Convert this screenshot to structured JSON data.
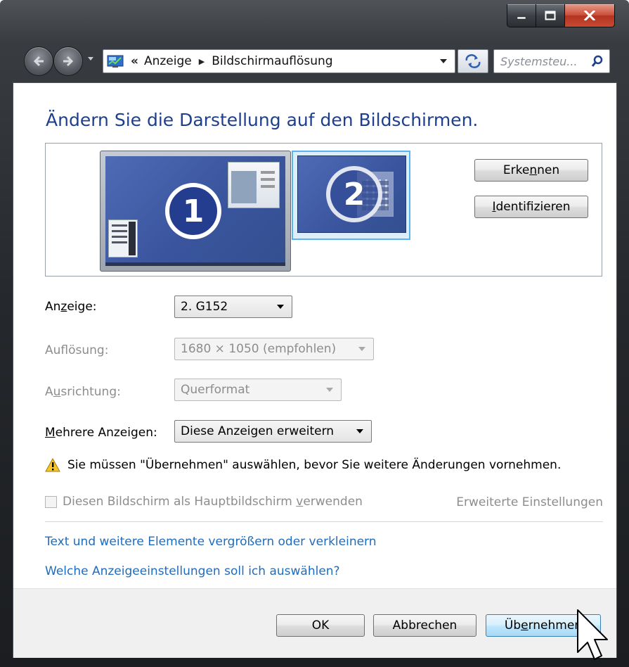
{
  "window": {
    "caption_buttons": [
      "minimize",
      "maximize",
      "close"
    ]
  },
  "navigation": {
    "address_separator": "«",
    "breadcrumb": [
      "Anzeige",
      "Bildschirmauflösung"
    ],
    "search_placeholder": "Systemsteu..."
  },
  "main": {
    "heading": "Ändern Sie die Darstellung auf den Bildschirmen.",
    "preview": {
      "monitors": [
        {
          "number": "1",
          "selected": false
        },
        {
          "number": "2",
          "selected": true
        }
      ],
      "detect_button": {
        "pre": "Erke",
        "mnemonic": "n",
        "post": "nen"
      },
      "identify_button": {
        "pre": "",
        "mnemonic": "I",
        "post": "dentifizieren"
      }
    },
    "settings": {
      "display": {
        "label_pre": "An",
        "label_mnemonic": "z",
        "label_post": "eige:",
        "value": "2. G152"
      },
      "resolution": {
        "label_pre": "Auf",
        "label_mnemonic": "l",
        "label_post": "ösung:",
        "value": "1680 × 1050 (empfohlen)",
        "disabled": true
      },
      "orientation": {
        "label_pre": "A",
        "label_mnemonic": "u",
        "label_post": "srichtung:",
        "value": "Querformat",
        "disabled": true
      },
      "multiple": {
        "label_pre": "",
        "label_mnemonic": "M",
        "label_post": "ehrere Anzeigen:",
        "value": "Diese Anzeigen erweitern"
      }
    },
    "warning": "Sie müssen \"Übernehmen\" auswählen, bevor Sie weitere Änderungen vornehmen.",
    "primary_checkbox": {
      "label_pre": "Diesen Bildschirm als Hauptbildschirm ",
      "label_mnemonic": "v",
      "label_post": "erwenden",
      "checked": false,
      "disabled": true
    },
    "advanced_link": "Erweiterte Einstellungen",
    "links": [
      "Text und weitere Elemente vergrößern oder verkleinern",
      "Welche Anzeigeeinstellungen soll ich auswählen?"
    ]
  },
  "footer": {
    "ok": "OK",
    "cancel": "Abbrechen",
    "apply": {
      "pre": "Üb",
      "mnemonic": "e",
      "post": "rnehmen"
    }
  },
  "colors": {
    "heading": "#1e3f8c",
    "link": "#1f6cbf",
    "monitor_selected_border": "#5ab4ef"
  }
}
